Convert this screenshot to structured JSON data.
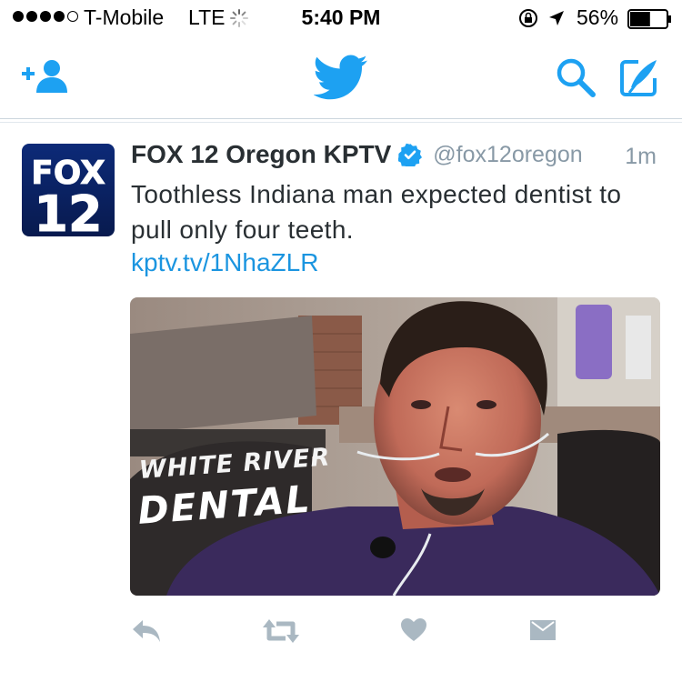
{
  "status_bar": {
    "carrier": "T-Mobile",
    "network": "LTE",
    "time": "5:40 PM",
    "battery": "56%",
    "battery_level": 0.56,
    "signal_bars": 4
  },
  "nav": {
    "icons": [
      "add-user-icon",
      "twitter-bird-icon",
      "search-icon",
      "compose-icon"
    ],
    "accent_color": "#1da1f2"
  },
  "tweet": {
    "author": "FOX 12 Oregon KPTV",
    "handle": "@fox12oregon",
    "time": "1m",
    "text": "Toothless Indiana man expected dentist to pull only four teeth.",
    "link": "kptv.tv/1NhaZLR",
    "avatar": {
      "line1": "FOX",
      "line2": "12"
    },
    "media": {
      "sign_line1": "WHITE RIVER",
      "sign_line2": "DENTAL"
    },
    "actions": [
      "reply-icon",
      "retweet-icon",
      "like-icon",
      "direct-message-icon"
    ]
  },
  "colors": {
    "link": "#1b95e0",
    "muted": "#8899a6",
    "text": "#292f33",
    "action_icons": "#aab8c2"
  }
}
